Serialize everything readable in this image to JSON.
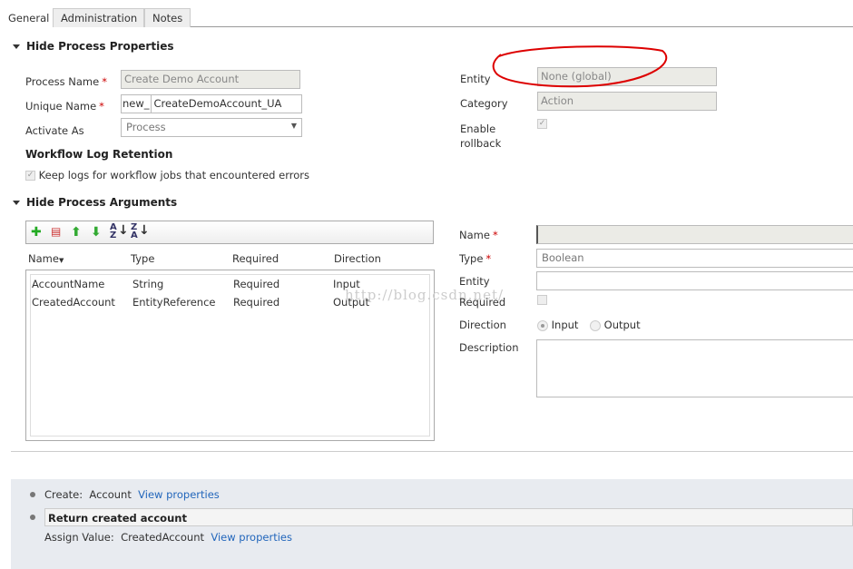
{
  "tabs": [
    {
      "label": "General",
      "active": true
    },
    {
      "label": "Administration"
    },
    {
      "label": "Notes"
    }
  ],
  "properties": {
    "section_title": "Hide Process Properties",
    "process_name_label": "Process Name",
    "process_name_value": "Create Demo Account",
    "unique_name_label": "Unique Name",
    "unique_name_prefix": "new_",
    "unique_name_value": "CreateDemoAccount_UA",
    "activate_as_label": "Activate As",
    "activate_as_value": "Process",
    "log_retention_title": "Workflow Log Retention",
    "keep_logs_label": "Keep logs for workflow jobs that encountered errors",
    "keep_logs_checked": true,
    "entity_label": "Entity",
    "entity_value": "None (global)",
    "category_label": "Category",
    "category_value": "Action",
    "enable_rollback_label": "Enable rollback",
    "enable_rollback_checked": true,
    "required_mark": "*"
  },
  "arguments": {
    "section_title": "Hide Process Arguments",
    "toolbar_icons": [
      "add-icon",
      "delete-icon",
      "move-up-icon",
      "move-down-icon",
      "sort-az-icon",
      "sort-za-icon"
    ],
    "columns": [
      "Name",
      "Type",
      "Required",
      "Direction"
    ],
    "rows": [
      [
        "AccountName",
        "String",
        "Required",
        "Input"
      ],
      [
        "CreatedAccount",
        "EntityReference",
        "Required",
        "Output"
      ]
    ],
    "detail": {
      "name_label": "Name",
      "name_value": "",
      "type_label": "Type",
      "type_value": "Boolean",
      "entity_label": "Entity",
      "entity_value": "",
      "required_label": "Required",
      "required_checked": false,
      "direction_label": "Direction",
      "direction_input": "Input",
      "direction_output": "Output",
      "direction_selected": "Input",
      "description_label": "Description"
    }
  },
  "steps": [
    {
      "prefix": "Create:",
      "target": "Account",
      "link": "View properties"
    },
    {
      "title": "Return created account",
      "prefix": "Assign Value:",
      "target": "CreatedAccount",
      "link": "View properties"
    }
  ],
  "watermark": "http://blog.csdn.net/",
  "colors": {
    "required": "#cc0000",
    "link": "#2266bb",
    "annotation": "#dd0000"
  }
}
